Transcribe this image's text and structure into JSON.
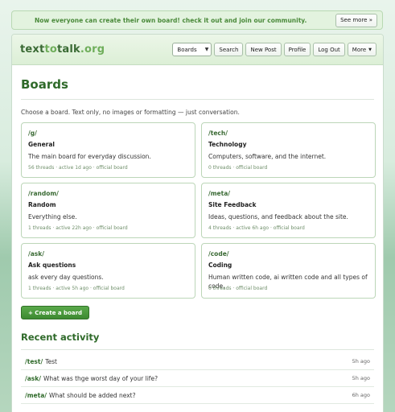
{
  "announcement": {
    "text": "Now everyone can create their own board! check it out and join our community.",
    "button": "See more »"
  },
  "header": {
    "logo": {
      "part1": "text",
      "part2": "to",
      "part3": "talk",
      "part4": ".org"
    },
    "select_value": "Boards",
    "buttons": [
      "Search",
      "New Post",
      "Profile",
      "Log Out"
    ],
    "more_label": "More"
  },
  "page": {
    "title": "Boards",
    "intro": "Choose a board. Text only, no images or formatting — just conversation."
  },
  "boards": [
    {
      "path": "/g/",
      "name": "General",
      "desc": "The main board for everyday discussion.",
      "meta": "56 threads · active 1d ago · official board"
    },
    {
      "path": "/tech/",
      "name": "Technology",
      "desc": "Computers, software, and the internet.",
      "meta": "0 threads · official board"
    },
    {
      "path": "/random/",
      "name": "Random",
      "desc": "Everything else.",
      "meta": "1 threads · active 22h ago · official board"
    },
    {
      "path": "/meta/",
      "name": "Site Feedback",
      "desc": "Ideas, questions, and feedback about the site.",
      "meta": "4 threads · active 6h ago · official board"
    },
    {
      "path": "/ask/",
      "name": "Ask questions",
      "desc": "ask every day questions.",
      "meta": "1 threads · active 5h ago · official board"
    },
    {
      "path": "/code/",
      "name": "Coding",
      "desc": "Human written code, ai written code and all types of code.",
      "meta": "0 threads · official board"
    }
  ],
  "create_button": "+ Create a board",
  "recent": {
    "title": "Recent activity",
    "items": [
      {
        "board": "/test/",
        "title": "Test",
        "time": "5h ago"
      },
      {
        "board": "/ask/",
        "title": "What was thge worst day of your life?",
        "time": "5h ago"
      },
      {
        "board": "/meta/",
        "title": "What should be added next?",
        "time": "6h ago"
      }
    ]
  }
}
